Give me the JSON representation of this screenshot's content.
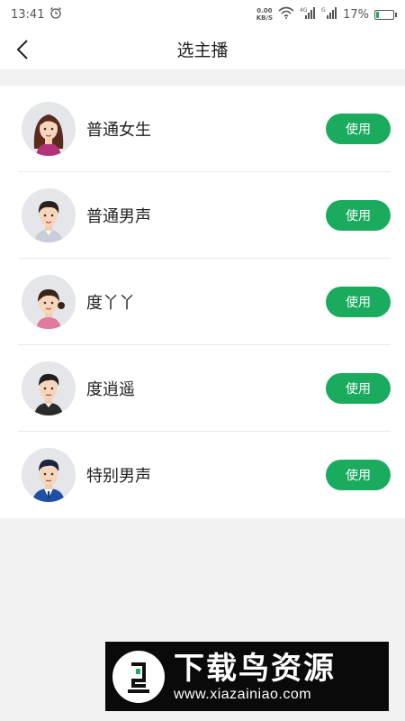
{
  "status_bar": {
    "time": "13:41",
    "net_speed_value": "0.00",
    "net_speed_unit": "KB/S",
    "battery_percent": "17%",
    "battery_level": 0.17,
    "icons": [
      "alarm-icon",
      "wifi-icon",
      "signal-4g-icon",
      "signal-g-icon",
      "battery-icon"
    ]
  },
  "nav": {
    "back_icon": "back-arrow-icon",
    "title": "选主播"
  },
  "anchors": [
    {
      "name": "普通女生",
      "use_label": "使用",
      "avatar": "female-avatar"
    },
    {
      "name": "普通男声",
      "use_label": "使用",
      "avatar": "male-avatar"
    },
    {
      "name": "度丫丫",
      "use_label": "使用",
      "avatar": "girl-avatar"
    },
    {
      "name": "度逍遥",
      "use_label": "使用",
      "avatar": "young-male-avatar"
    },
    {
      "name": "特别男声",
      "use_label": "使用",
      "avatar": "suit-male-avatar"
    }
  ],
  "watermark": {
    "title": "下载鸟资源",
    "url": "www.xiazainiao.com"
  },
  "colors": {
    "accent": "#1aab5f",
    "background": "#f2f2f2",
    "card": "#ffffff"
  }
}
